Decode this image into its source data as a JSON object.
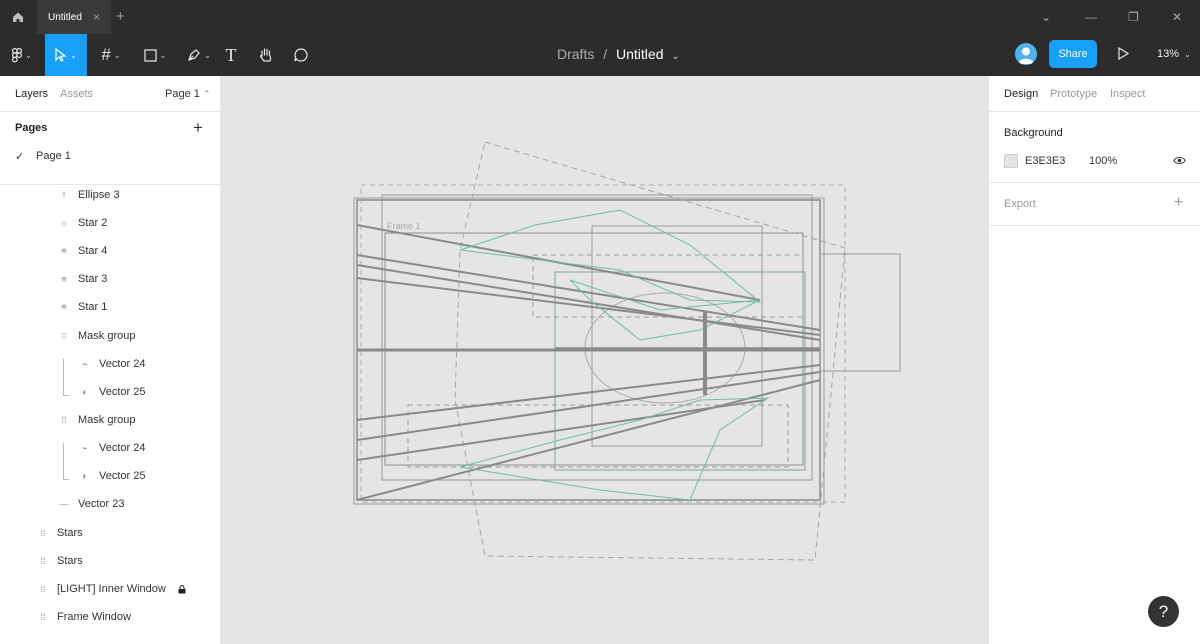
{
  "tabbar": {
    "tab_title": "Untitled",
    "tab_close": "×",
    "new_tab": "+",
    "win_min": "⌄",
    "win_minimize": "—",
    "win_restore": "❐",
    "win_close": "✕"
  },
  "toolbar": {
    "frame_tool": "#",
    "text_tool": "T",
    "caret": "⌄"
  },
  "breadcrumb": {
    "project": "Drafts",
    "separator": "/",
    "file": "Untitled",
    "chevron": "⌄"
  },
  "actions": {
    "share_label": "Share",
    "zoom_level": "13%",
    "zoom_caret": "⌄"
  },
  "left_panel": {
    "tabs": [
      "Layers",
      "Assets"
    ],
    "page_selector": "Page 1",
    "page_selector_caret": "⌃",
    "pages_heading": "Pages",
    "add_page": "+",
    "pages": [
      {
        "name": "Page 1",
        "check": "✓"
      }
    ],
    "layers": [
      {
        "name": "Ellipse 3",
        "icon": "!"
      },
      {
        "name": "Star 2",
        "icon": "☼"
      },
      {
        "name": "Star 4",
        "icon": "✳"
      },
      {
        "name": "Star 3",
        "icon": "✳"
      },
      {
        "name": "Star 1",
        "icon": "✳"
      },
      {
        "name": "Mask group",
        "icon": "⁞⁞"
      },
      {
        "name": "Vector 24",
        "icon": "⌁"
      },
      {
        "name": "Vector 25",
        "icon": "◐"
      },
      {
        "name": "Mask group",
        "icon": "⁞⁞"
      },
      {
        "name": "Vector 24",
        "icon": "⌁"
      },
      {
        "name": "Vector 25",
        "icon": "◐"
      },
      {
        "name": "Vector 23",
        "icon": "—"
      },
      {
        "name": "Stars",
        "icon": "⁞⁞"
      },
      {
        "name": "Stars",
        "icon": "⁞⁞"
      },
      {
        "name": "[LIGHT] Inner Window",
        "icon": "⁞⁞"
      },
      {
        "name": "Frame Window",
        "icon": "⁞⁞"
      }
    ]
  },
  "canvas": {
    "frame_label": "Frame 1"
  },
  "right_panel": {
    "tabs": [
      "Design",
      "Prototype",
      "Inspect"
    ],
    "background_heading": "Background",
    "bg_hex": "E3E3E3",
    "bg_opacity": "100%",
    "bg_color": "#e3e3e3",
    "export_heading": "Export",
    "add_export": "+"
  },
  "help": {
    "label": "?"
  },
  "colors": {
    "accent": "#18a0fb",
    "toolbar": "#2c2c2c"
  }
}
